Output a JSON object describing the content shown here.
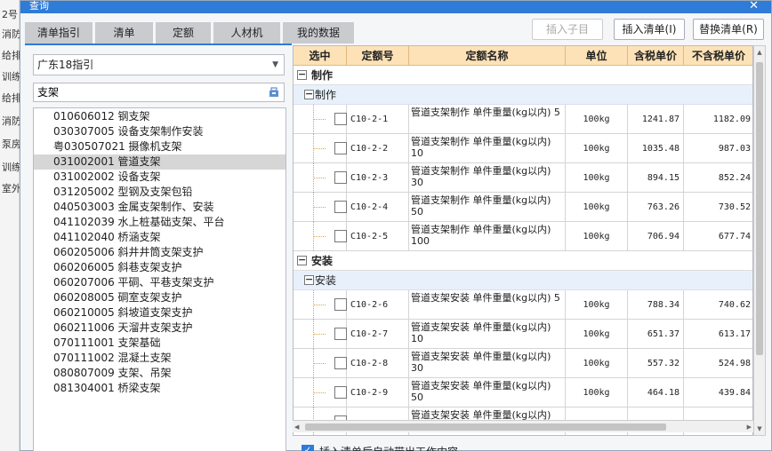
{
  "background_app": {
    "items": [
      "2号",
      "消防",
      "给排",
      "训练",
      "给排",
      "消防",
      "泵房",
      "训练",
      "室外"
    ]
  },
  "dialog": {
    "title": "查询",
    "close_label": "✕"
  },
  "tabs": [
    {
      "label": "清单指引",
      "active": true
    },
    {
      "label": "清单",
      "active": false
    },
    {
      "label": "定额",
      "active": false
    },
    {
      "label": "人材机",
      "active": false
    },
    {
      "label": "我的数据",
      "active": false
    }
  ],
  "toolbar": {
    "insert_child_label": "插入子目",
    "insert_list_label": "插入清单(I)",
    "replace_list_label": "替换清单(R)"
  },
  "left_panel": {
    "guide_select_value": "广东18指引",
    "search_value": "支架",
    "items": [
      {
        "code": "010606012",
        "name": "钢支架"
      },
      {
        "code": "030307005",
        "name": "设备支架制作安装"
      },
      {
        "code": "粤030507021",
        "name": "摄像机支架"
      },
      {
        "code": "031002001",
        "name": "管道支架"
      },
      {
        "code": "031002002",
        "name": "设备支架"
      },
      {
        "code": "031205002",
        "name": "型钢及支架包铅"
      },
      {
        "code": "040503003",
        "name": "金属支架制作、安装"
      },
      {
        "code": "041102039",
        "name": "水上桩基础支架、平台"
      },
      {
        "code": "041102040",
        "name": "桥涵支架"
      },
      {
        "code": "060205006",
        "name": "斜井井筒支架支护"
      },
      {
        "code": "060206005",
        "name": "斜巷支架支护"
      },
      {
        "code": "060207006",
        "name": "平硐、平巷支架支护"
      },
      {
        "code": "060208005",
        "name": "硐室支架支护"
      },
      {
        "code": "060210005",
        "name": "斜坡道支架支护"
      },
      {
        "code": "060211006",
        "name": "天溜井支架支护"
      },
      {
        "code": "070111001",
        "name": "支架基础"
      },
      {
        "code": "070111002",
        "name": "混凝土支架"
      },
      {
        "code": "080807009",
        "name": "支架、吊架"
      },
      {
        "code": "081304001",
        "name": "桥梁支架"
      }
    ],
    "selected_code": "031002001"
  },
  "grid": {
    "columns": [
      "选中",
      "定额号",
      "定额名称",
      "单位",
      "含税单价",
      "不含税单价"
    ],
    "groups": [
      {
        "label": "制作",
        "sub_label": "制作",
        "rows": [
          {
            "code": "C10-2-1",
            "name": "管道支架制作 单件重量(kg以内) 5",
            "unit": "100kg",
            "price_tax": "1241.87",
            "price_notax": "1182.09"
          },
          {
            "code": "C10-2-2",
            "name": "管道支架制作 单件重量(kg以内) 10",
            "unit": "100kg",
            "price_tax": "1035.48",
            "price_notax": "987.03"
          },
          {
            "code": "C10-2-3",
            "name": "管道支架制作 单件重量(kg以内) 30",
            "unit": "100kg",
            "price_tax": "894.15",
            "price_notax": "852.24"
          },
          {
            "code": "C10-2-4",
            "name": "管道支架制作 单件重量(kg以内) 50",
            "unit": "100kg",
            "price_tax": "763.26",
            "price_notax": "730.52"
          },
          {
            "code": "C10-2-5",
            "name": "管道支架制作 单件重量(kg以内) 100",
            "unit": "100kg",
            "price_tax": "706.94",
            "price_notax": "677.74"
          }
        ]
      },
      {
        "label": "安装",
        "sub_label": "安装",
        "rows": [
          {
            "code": "C10-2-6",
            "name": "管道支架安装 单件重量(kg以内) 5",
            "unit": "100kg",
            "price_tax": "788.34",
            "price_notax": "740.62"
          },
          {
            "code": "C10-2-7",
            "name": "管道支架安装 单件重量(kg以内) 10",
            "unit": "100kg",
            "price_tax": "651.37",
            "price_notax": "613.17"
          },
          {
            "code": "C10-2-8",
            "name": "管道支架安装 单件重量(kg以内) 30",
            "unit": "100kg",
            "price_tax": "557.32",
            "price_notax": "524.98"
          },
          {
            "code": "C10-2-9",
            "name": "管道支架安装 单件重量(kg以内) 50",
            "unit": "100kg",
            "price_tax": "464.18",
            "price_notax": "439.84"
          },
          {
            "code": "",
            "name": "管道支架安装 单件重量(kg以内)",
            "unit": "",
            "price_tax": "",
            "price_notax": ""
          }
        ]
      }
    ]
  },
  "footer": {
    "auto_expand_label": "插入清单后自动带出工作内容",
    "auto_expand_checked": true
  },
  "icons": {
    "search": "search-icon",
    "close": "close-icon",
    "collapse": "collapse-icon",
    "dropdown": "chevron-down-icon"
  },
  "colors": {
    "accent": "#2f7bd8",
    "header_bg": "#fde2b8",
    "sub_row_bg": "#e8f1fb"
  }
}
